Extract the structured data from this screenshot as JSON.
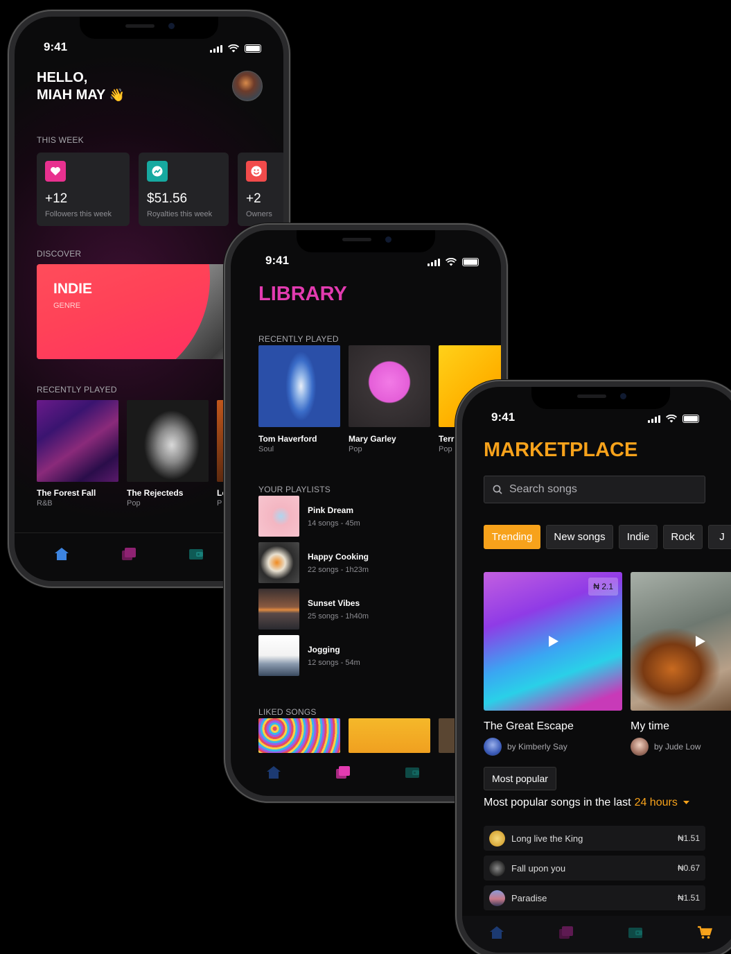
{
  "status_time": "9:41",
  "home": {
    "greeting_line1": "HELLO,",
    "greeting_line2": "MIAH MAY",
    "wave_emoji": "👋",
    "this_week_label": "THIS WEEK",
    "stats": [
      {
        "value": "+12",
        "label": "Followers this week",
        "color": "#e8318f"
      },
      {
        "value": "$51.56",
        "label": "Royalties this week",
        "color": "#17a9a0"
      },
      {
        "value": "+2",
        "label": "Owners",
        "color": "#f24b4b"
      }
    ],
    "discover_label": "DISCOVER",
    "discover_title": "INDIE",
    "discover_subtitle": "GENRE",
    "recently_played_label": "RECENTLY PLAYED",
    "recent": [
      {
        "title": "The Forest Fall",
        "genre": "R&B"
      },
      {
        "title": "The Rejecteds",
        "genre": "Pop"
      },
      {
        "title": "Lo",
        "genre": "P"
      }
    ]
  },
  "library": {
    "title": "LIBRARY",
    "recently_played_label": "RECENTLY PLAYED",
    "recent": [
      {
        "title": "Tom Haverford",
        "genre": "Soul"
      },
      {
        "title": "Mary Garley",
        "genre": "Pop"
      },
      {
        "title": "Terr",
        "genre": "Pop"
      }
    ],
    "playlists_label": "YOUR PLAYLISTS",
    "playlists": [
      {
        "title": "Pink Dream",
        "meta": "14 songs  -  45m"
      },
      {
        "title": "Happy Cooking",
        "meta": "22 songs  -  1h23m"
      },
      {
        "title": "Sunset Vibes",
        "meta": "25 songs  -  1h40m"
      },
      {
        "title": "Jogging",
        "meta": "12 songs  -  54m"
      }
    ],
    "liked_label": "LIKED SONGS"
  },
  "market": {
    "title": "MARKETPLACE",
    "search_placeholder": "Search songs",
    "chips": [
      "Trending",
      "New songs",
      "Indie",
      "Rock",
      "J"
    ],
    "cards": [
      {
        "title": "The Great Escape",
        "artist": "by Kimberly Say",
        "price": "₦ 2.1"
      },
      {
        "title": "My time",
        "artist": "by Jude Low"
      }
    ],
    "most_popular_button": "Most popular",
    "popular_heading_prefix": "Most popular songs in the last",
    "popular_heading_highlight": "24 hours",
    "songs": [
      {
        "title": "Long live the King",
        "price": "₦1.51"
      },
      {
        "title": "Fall upon you",
        "price": "₦0.67"
      },
      {
        "title": "Paradise",
        "price": "₦1.51"
      }
    ],
    "accent": "#f7a21b"
  },
  "colors": {
    "library_accent": "#e23bb0",
    "home_accent": "#3d84e0",
    "market_accent": "#f7a21b"
  },
  "icons": [
    "home-icon",
    "library-icon",
    "wallet-icon",
    "cart-icon",
    "heart-icon",
    "trend-icon",
    "smile-icon",
    "search-icon",
    "play-icon",
    "caret-down-icon"
  ]
}
